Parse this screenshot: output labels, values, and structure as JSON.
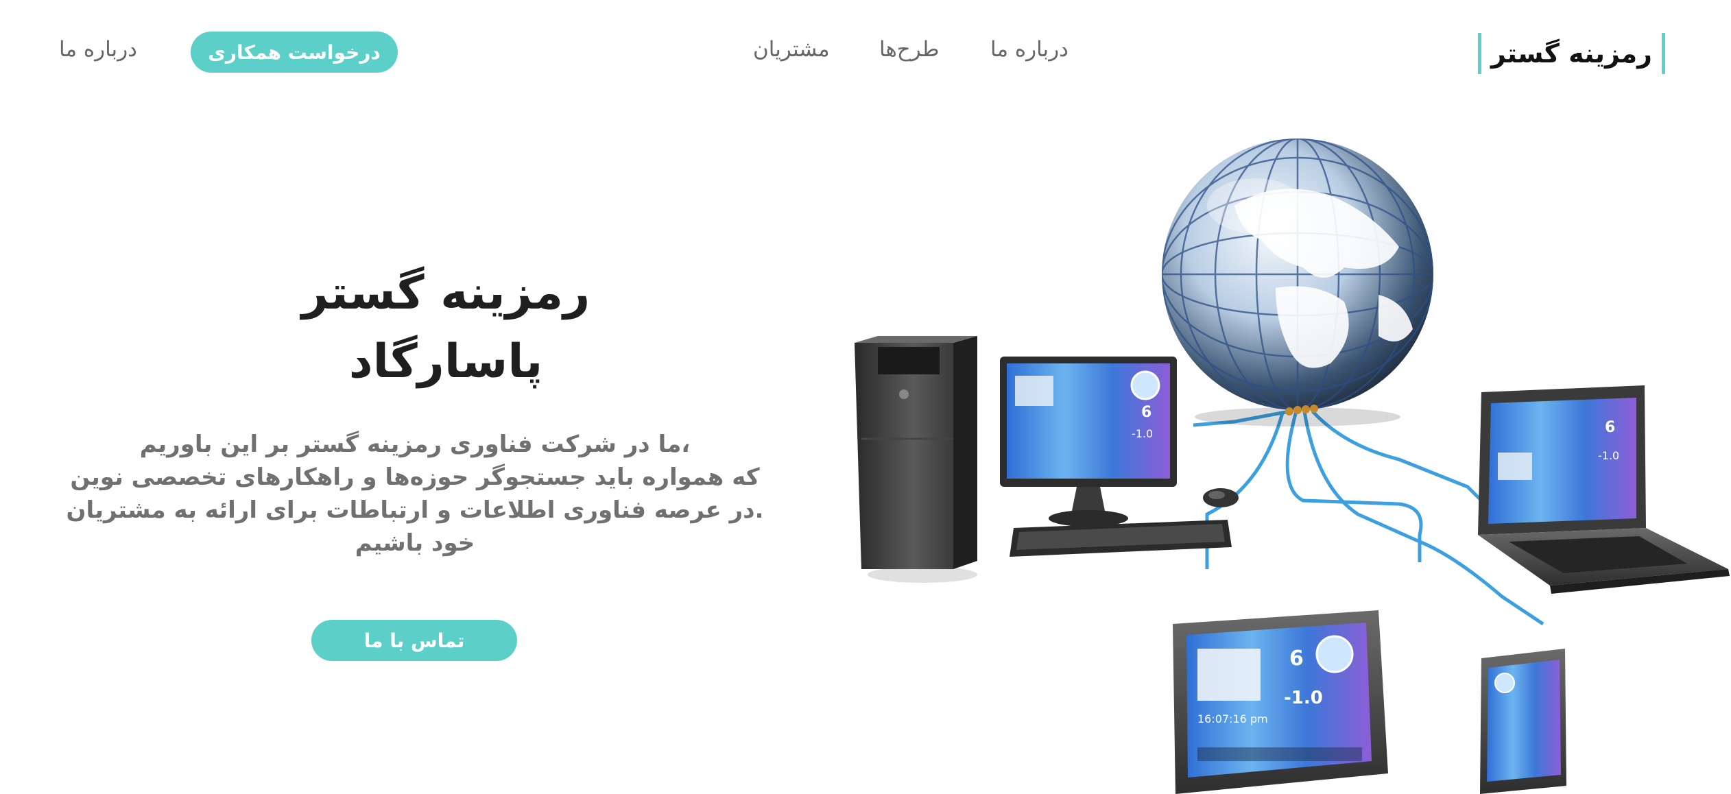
{
  "brand": {
    "logo_text": "رمزینه گستر"
  },
  "nav": {
    "links": [
      "درباره ما",
      "طرح‌ها",
      "مشتریان"
    ],
    "cta_label": "درخواست همکاری",
    "left_link": "درباره ما"
  },
  "hero": {
    "title_line1": "رمزینه گستر",
    "title_line2": "پاسارگاد",
    "desc_line1": "،ما در شرکت فناوری رمزینه گستر بر این باوریم",
    "desc_line2": "که همواره باید جستجوگر حوزه‌ها و راهکارهای تخصصی نوین",
    "desc_line3": ".در عرصه فناوری اطلاعات و ارتباطات برای ارائه به مشتریان خود باشیم",
    "contact_label": "تماس با ما"
  },
  "illustration": {
    "tablet_day": "6",
    "tablet_temp": "-1.0",
    "tablet_time": "16:07:16 pm",
    "monitor_day": "6",
    "monitor_temp": "-1.0",
    "laptop_day": "6",
    "laptop_temp": "-1.0"
  },
  "colors": {
    "accent": "#5ccfc9",
    "text_dark": "#1f1f1f",
    "text_muted": "#707070"
  }
}
